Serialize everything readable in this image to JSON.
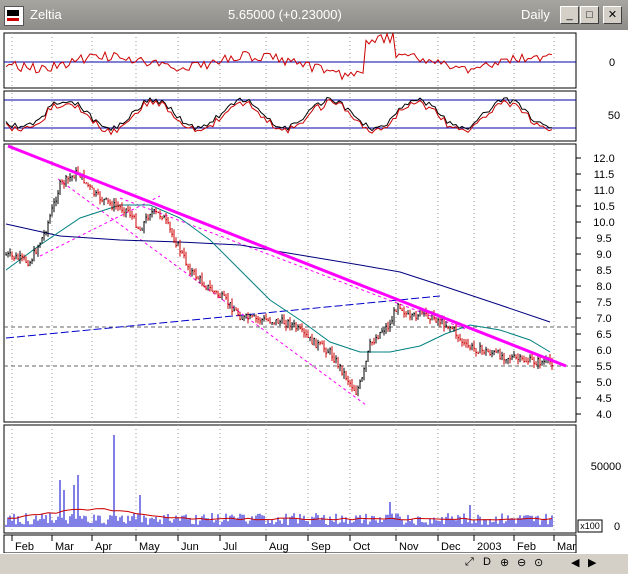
{
  "window": {
    "title": "Zeltia",
    "price": "5.65000 (+0.23000)",
    "period": "Daily",
    "minimize": "_",
    "maximize": "□",
    "close": "✕"
  },
  "panels": {
    "oscillator": {
      "ticks": [
        "0"
      ]
    },
    "stochastic": {
      "ticks": [
        "50"
      ]
    },
    "price": {
      "ticks": [
        "12.0",
        "11.5",
        "11.0",
        "10.5",
        "10.0",
        "9.5",
        "9.0",
        "8.5",
        "8.0",
        "7.5",
        "7.0",
        "6.5",
        "6.0",
        "5.5",
        "5.0",
        "4.5",
        "4.0"
      ]
    },
    "volume": {
      "ticks": [
        "50000",
        "0"
      ],
      "multiplier": "x100"
    }
  },
  "months": [
    "Feb",
    "Mar",
    "Apr",
    "May",
    "Jun",
    "Jul",
    "Aug",
    "Sep",
    "Oct",
    "Nov",
    "Dec",
    "2003",
    "Feb",
    "Mar"
  ],
  "colors": {
    "up": "#000000",
    "down": "#cc0000",
    "trend": "#ff00ff",
    "ma_long": "#000080",
    "ma_mid": "#008080",
    "volume": "#0000cc"
  },
  "scrollbar": {
    "icons": [
      "expand-icon",
      "zoom-in-icon",
      "zoom-out-icon",
      "scroll-left-icon",
      "scroll-right-icon"
    ]
  }
}
